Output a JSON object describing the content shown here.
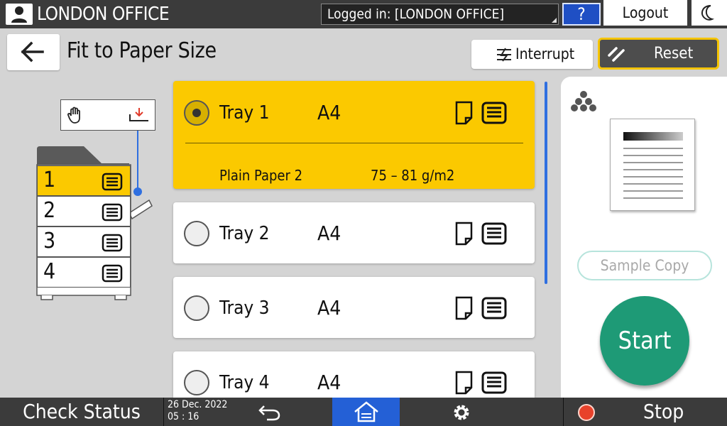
{
  "header": {
    "office_name": "LONDON OFFICE",
    "login_status": "Logged in: [LONDON OFFICE]",
    "help_label": "?",
    "logout_label": "Logout",
    "icons": [
      "user-icon",
      "moon-icon"
    ]
  },
  "title_row": {
    "page_title": "Fit to Paper Size",
    "interrupt_label": "Interrupt",
    "reset_label": "Reset"
  },
  "machine": {
    "trays": [
      "1",
      "2",
      "3",
      "4"
    ],
    "active_tray": "1"
  },
  "trays": [
    {
      "name": "Tray 1",
      "size": "A4",
      "selected": true,
      "paper_type": "Plain Paper 2",
      "paper_weight": "75 – 81 g/m2"
    },
    {
      "name": "Tray 2",
      "size": "A4",
      "selected": false
    },
    {
      "name": "Tray 3",
      "size": "A4",
      "selected": false
    },
    {
      "name": "Tray 4",
      "size": "A4",
      "selected": false
    }
  ],
  "preview": {
    "sample_copy_label": "Sample Copy",
    "start_label": "Start"
  },
  "footer": {
    "check_status_label": "Check Status",
    "date": "26 Dec. 2022",
    "time": "05 : 16",
    "stop_label": "Stop"
  },
  "colors": {
    "accent_yellow": "#fbc900",
    "blue": "#2460d6",
    "start_green": "#1e9a76",
    "stop_red": "#e8422b"
  }
}
